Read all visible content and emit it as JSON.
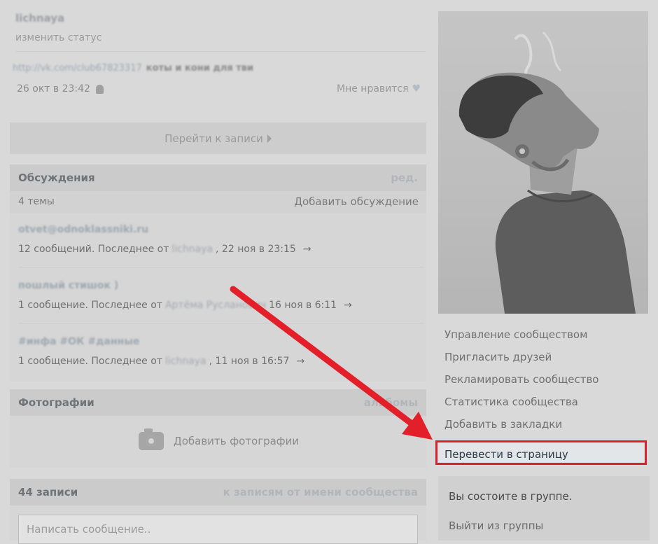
{
  "status": {
    "name": "lichnaya",
    "edit_label": "изменить статус"
  },
  "post": {
    "link": "http://vk.com/club67823317",
    "text": "коты и кони для тви",
    "time": "26 окт в 23:42",
    "like_label": "Мне нравится",
    "goto_label": "Перейти к записи"
  },
  "discussions": {
    "title": "Обсуждения",
    "edit_label": "ред.",
    "count_label": "4 темы",
    "add_label": "Добавить обсуждение",
    "topics": [
      {
        "title": "otvet@odnoklassniki.ru",
        "prefix": "12 сообщений. Последнее от",
        "author": "lichnaya",
        "date": ", 22 ноя в 23:15"
      },
      {
        "title": "пошлый стишок )",
        "prefix": "1 сообщение. Последнее от",
        "author": "Артёма Русланович",
        "date": "16 ноя в 6:11"
      },
      {
        "title": "#инфа #ОК #данные",
        "prefix": "1 сообщение. Последнее от",
        "author": "lichnaya",
        "date": ", 11 ноя в 16:57"
      }
    ],
    "arrow": "→"
  },
  "photos": {
    "title": "Фотографии",
    "albums_label": "альбомы",
    "add_label": "Добавить фотографии"
  },
  "wall": {
    "title": "44 записи",
    "filter_label": "к записям от имени сообщества",
    "compose_placeholder": "Написать сообщение.."
  },
  "sidebar": {
    "menu": [
      "Управление сообществом",
      "Пригласить друзей",
      "Рекламировать сообщество",
      "Статистика сообщества",
      "Добавить в закладки"
    ],
    "highlighted": "Перевести в страницу",
    "member_status": "Вы состоите в группе.",
    "leave_label": "Выйти из группы"
  },
  "colors": {
    "annotation_arrow": "#e3202a",
    "highlight_border": "#d8222a"
  },
  "icons": {
    "android": "android-icon",
    "like": "heart-icon",
    "goto": "triangle-right-icon",
    "camera": "camera-icon"
  }
}
